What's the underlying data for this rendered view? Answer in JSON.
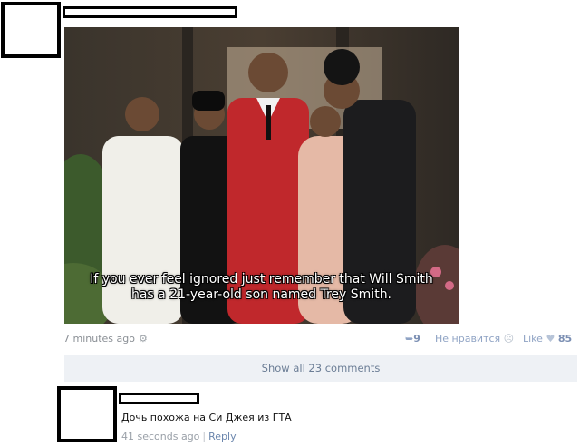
{
  "post": {
    "image_caption_line1": "If you ever feel ignored just remember that Will Smith",
    "image_caption_line2": "has a 21-year-old son named Trey Smith.",
    "time": "7 minutes ago",
    "reshare_count": "9",
    "dislike_label": "Не нравится",
    "like_label": "Like",
    "like_count": "85",
    "show_all_label": "Show all 23 comments"
  },
  "comment": {
    "text": "Дочь похожа на Си Джея из ГТА",
    "time": "41 seconds ago",
    "separator": "|",
    "reply_label": "Reply"
  },
  "icons": {
    "gear": "gear-icon",
    "reshare": "reshare-icon",
    "dislike": "dislike-icon",
    "like": "heart-icon"
  },
  "colors": {
    "accent": "#6b86ad",
    "muted": "#8a8f95",
    "bar_bg": "#eef1f5"
  }
}
